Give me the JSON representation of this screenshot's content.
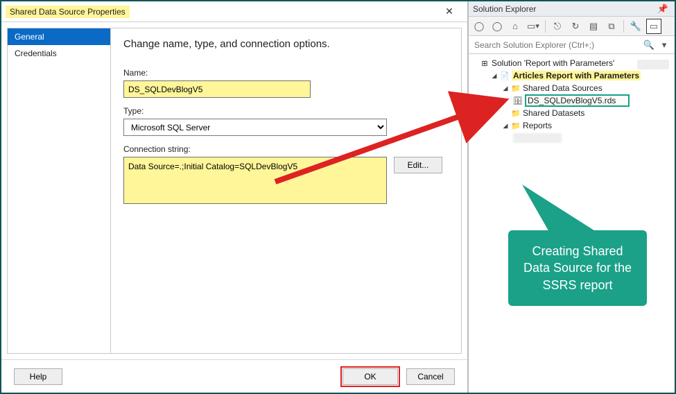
{
  "dialog": {
    "title": "Shared Data Source Properties",
    "close_glyph": "✕",
    "sidebar": {
      "items": [
        {
          "label": "General",
          "selected": true
        },
        {
          "label": "Credentials",
          "selected": false
        }
      ]
    },
    "heading": "Change name, type, and connection options.",
    "name_label": "Name:",
    "name_value": "DS_SQLDevBlogV5",
    "type_label": "Type:",
    "type_value": "Microsoft SQL Server",
    "conn_label": "Connection string:",
    "conn_value": "Data Source=.;Initial Catalog=SQLDevBlogV5",
    "edit_label": "Edit...",
    "help_label": "Help",
    "ok_label": "OK",
    "cancel_label": "Cancel"
  },
  "explorer": {
    "title": "Solution Explorer",
    "search_placeholder": "Search Solution Explorer (Ctrl+;)",
    "solution_label": "Solution 'Report with Parameters'",
    "project_label": "Articles Report with Parameters",
    "folders": {
      "shared_sources": "Shared Data Sources",
      "rds_item": "DS_SQLDevBlogV5.rds",
      "shared_datasets": "Shared Datasets",
      "reports": "Reports"
    }
  },
  "callout": {
    "text": "Creating Shared Data Source for the SSRS report"
  }
}
